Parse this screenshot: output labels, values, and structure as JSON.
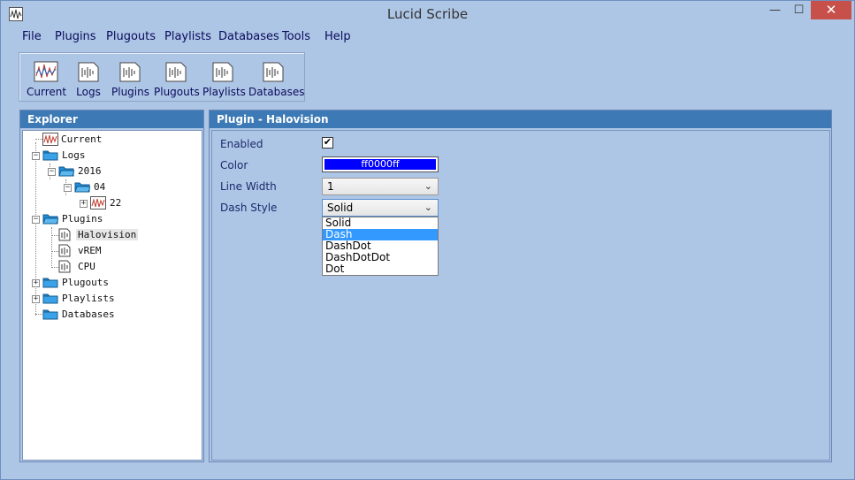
{
  "window": {
    "title": "Lucid Scribe",
    "controls": {
      "minimize": "—",
      "maximize": "☐",
      "close": "✕"
    }
  },
  "menu": [
    "File",
    "Plugins",
    "Plugouts",
    "Playlists",
    "Databases",
    "Tools",
    "Help"
  ],
  "toolbar": [
    {
      "label": "Current",
      "icon": "waveform-icon"
    },
    {
      "label": "Logs",
      "icon": "document-icon"
    },
    {
      "label": "Plugins",
      "icon": "document-icon"
    },
    {
      "label": "Plugouts",
      "icon": "document-icon"
    },
    {
      "label": "Playlists",
      "icon": "document-icon"
    },
    {
      "label": "Databases",
      "icon": "document-icon"
    }
  ],
  "explorer": {
    "header": "Explorer",
    "tree": [
      {
        "label": "Current",
        "icon": "waveform-icon"
      },
      {
        "label": "Logs",
        "icon": "folder-icon",
        "expander": "−"
      },
      {
        "label": "2016",
        "icon": "folder-icon",
        "expander": "−"
      },
      {
        "label": "04",
        "icon": "folder-icon",
        "expander": "−"
      },
      {
        "label": "22",
        "icon": "waveform-icon",
        "expander": "+"
      },
      {
        "label": "Plugins",
        "icon": "folder-icon",
        "expander": "−"
      },
      {
        "label": "Halovision",
        "icon": "plugin-icon",
        "selected": true
      },
      {
        "label": "vREM",
        "icon": "plugin-icon"
      },
      {
        "label": "CPU",
        "icon": "plugin-icon"
      },
      {
        "label": "Plugouts",
        "icon": "folder-icon",
        "expander": "+"
      },
      {
        "label": "Playlists",
        "icon": "folder-icon",
        "expander": "+"
      },
      {
        "label": "Databases",
        "icon": "folder-icon"
      }
    ]
  },
  "plugin": {
    "header": "Plugin - Halovision",
    "enabled_label": "Enabled",
    "enabled": true,
    "color_label": "Color",
    "color_value": "ff0000ff",
    "color_hex": "#0000ff",
    "line_width_label": "Line Width",
    "line_width_value": "1",
    "dash_style_label": "Dash Style",
    "dash_style_value": "Solid",
    "dash_options": [
      "Solid",
      "Dash",
      "DashDot",
      "DashDotDot",
      "Dot"
    ],
    "dash_highlighted": "Dash"
  }
}
